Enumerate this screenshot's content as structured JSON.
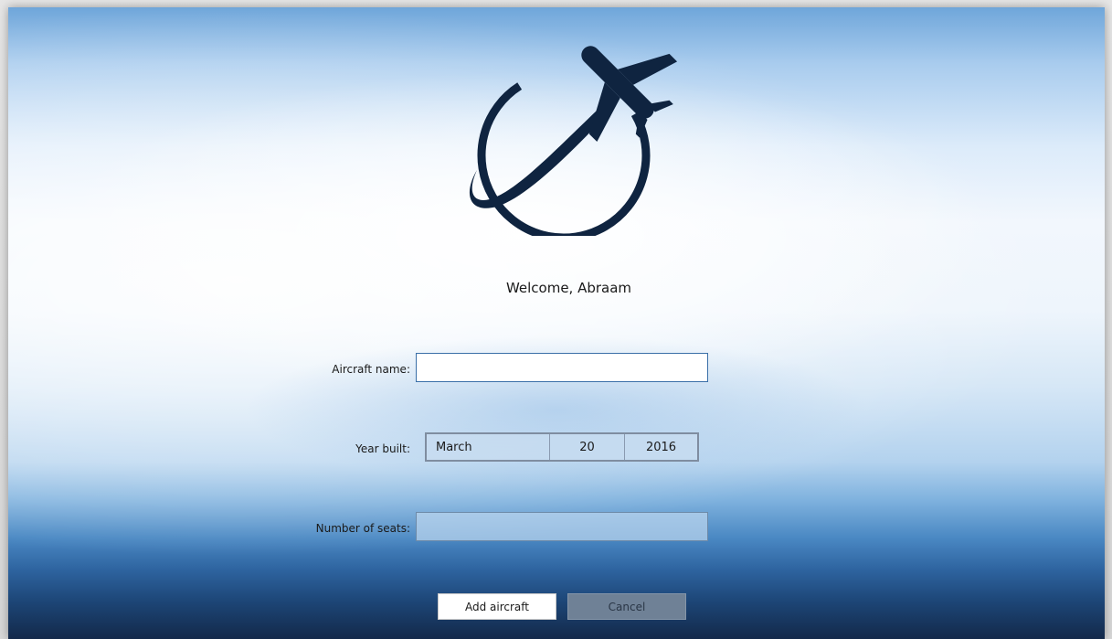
{
  "welcome_text": "Welcome, Abraam",
  "form": {
    "aircraft_name": {
      "label": "Aircraft name:",
      "value": ""
    },
    "year_built": {
      "label": "Year built:",
      "month": "March",
      "day": "20",
      "year": "2016"
    },
    "number_of_seats": {
      "label": "Number of seats:",
      "value": ""
    }
  },
  "buttons": {
    "add_label": "Add aircraft",
    "cancel_label": "Cancel"
  },
  "colors": {
    "logo": "#0f2440",
    "field_border": "#3a6fa8",
    "cancel_bg": "#6f8196"
  },
  "icons": {
    "logo": "airplane-globe-icon"
  }
}
